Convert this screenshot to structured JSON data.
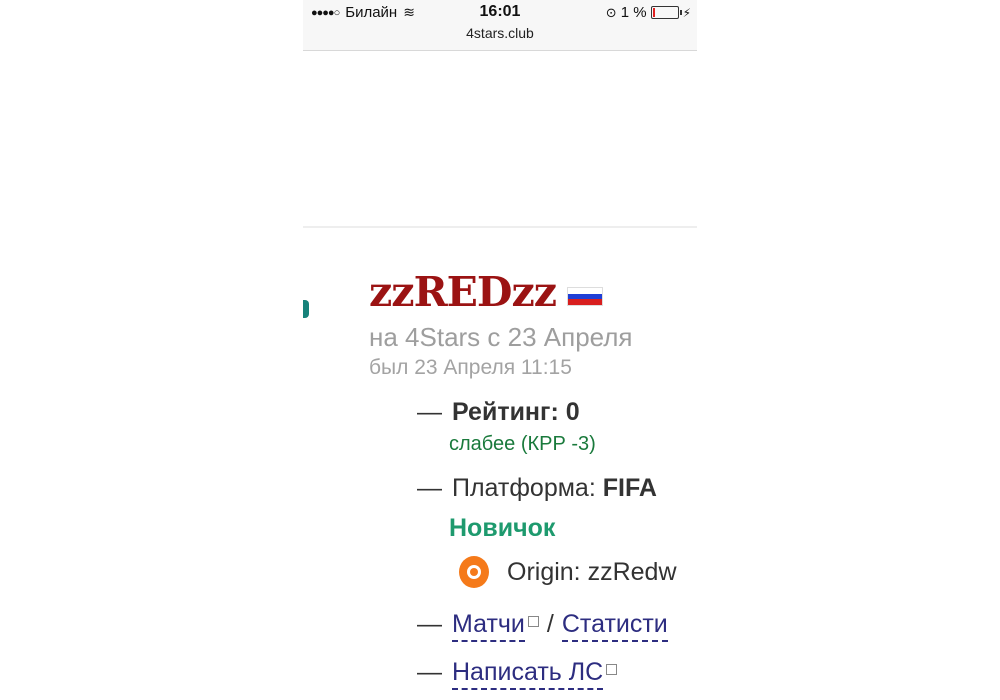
{
  "status_bar": {
    "signal": "●●●●○",
    "carrier": "Билайн",
    "time": "16:01",
    "battery": "1 %",
    "url": "4stars.club"
  },
  "profile": {
    "username": "zzREDzz",
    "since": "на 4Stars с 23 Апреля",
    "last_seen": "был 23 Апреля 11:15",
    "rating_label": "Рейтинг: 0",
    "rating_note": "слабее (КРР -3)",
    "platform_label": "Платформа:",
    "platform_value": "FIFA",
    "level": "Новичок",
    "origin": "Origin: zzRedw",
    "matches_link": "Матчи",
    "stats_link": "Статисти",
    "message_link": "Написать ЛС"
  },
  "colors": {
    "username": "#9b1313",
    "green_note": "#1a7a3c",
    "novice": "#1e9a6e",
    "link": "#2d2d80"
  }
}
